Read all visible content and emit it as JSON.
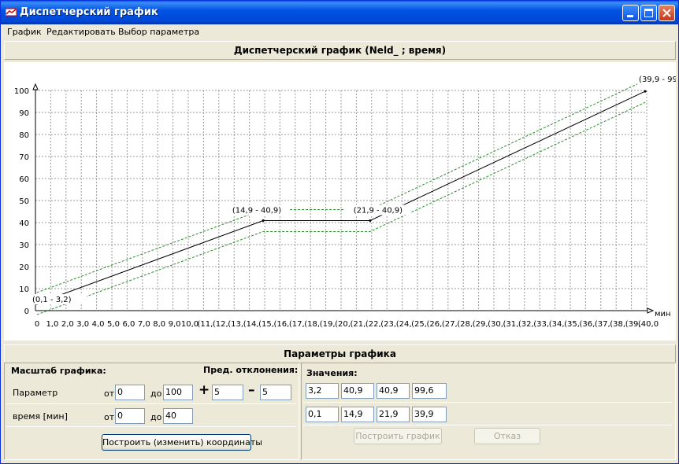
{
  "window": {
    "title": "Диспетчерский график"
  },
  "menu": [
    "График",
    "Редактировать",
    "Выбор параметра"
  ],
  "chart_header": "Диспетчерский график (Neld_ ; время)",
  "params_header": "Параметры графика",
  "chart_data": {
    "type": "line",
    "ylim": [
      0,
      100
    ],
    "xlim": [
      0,
      40
    ],
    "y_ticks": [
      "0",
      "10",
      "20",
      "30",
      "40",
      "50",
      "60",
      "70",
      "80",
      "90",
      "100"
    ],
    "x_ticks": [
      "0",
      "1,0",
      "2,0",
      "3,0",
      "4,0",
      "5,0",
      "6,0",
      "7,0",
      "8,0",
      "9,0",
      "10,0",
      "(11,",
      "(12,",
      "(13,",
      "(14,",
      "(15,",
      "(16,",
      "(17,",
      "(18,",
      "(19,",
      "(20,",
      "(21,",
      "(22,",
      "(23,",
      "(24,",
      "(25,",
      "(26,",
      "(27,",
      "(28,",
      "(29,",
      "(30,",
      "(31,",
      "(32,",
      "(33,",
      "(34,",
      "(35,",
      "(36,",
      "(37,",
      "(38,",
      "(39,",
      "(40,0"
    ],
    "xunit": "мин",
    "grid": true,
    "series": [
      {
        "x": [
          0.1,
          14.9,
          21.9,
          39.9
        ],
        "y": [
          3.2,
          40.9,
          40.9,
          99.6
        ]
      }
    ],
    "deviation_plus": 5,
    "deviation_minus": 5,
    "point_labels": [
      "(0,1 - 3,2)",
      "(14,9 - 40,9)",
      "(21,9 - 40,9)",
      "(39,9 - 99,"
    ]
  },
  "scale": {
    "title": "Масштаб графика:",
    "param_label": "Параметр",
    "time_label": "время  [мин]",
    "from": "от",
    "to": "до",
    "param_from": "0",
    "param_to": "100",
    "time_from": "0",
    "time_to": "40"
  },
  "deviation": {
    "title": "Пред. отклонения:",
    "plus_sign": "+",
    "minus_sign": "–",
    "plus": "5",
    "minus": "5"
  },
  "build_coords_button": "Построить (изменить) координаты",
  "values": {
    "title": "Значения:",
    "row1": [
      "3,2",
      "40,9",
      "40,9",
      "99,6"
    ],
    "row2": [
      "0,1",
      "14,9",
      "21,9",
      "39,9"
    ]
  },
  "build_chart_button": "Построить график",
  "cancel_button": "Отказ"
}
